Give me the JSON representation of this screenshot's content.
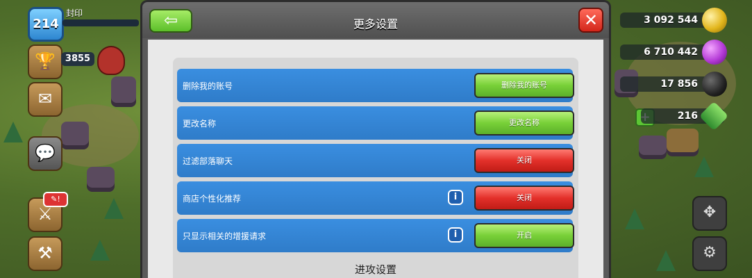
{
  "player": {
    "level": "214",
    "name": "封印",
    "trophies": "3855"
  },
  "resources": {
    "gold": "3 092 544",
    "elixir": "6 710 442",
    "dark_elixir": "17 856",
    "gems": "216"
  },
  "dialog": {
    "title": "更多设置",
    "back_icon": "left-arrow-icon",
    "close_icon": "close-x-icon",
    "rows": [
      {
        "label": "删除我的账号",
        "button": "删除我的账号",
        "color": "#78d038",
        "has_info": false
      },
      {
        "label": "更改名称",
        "button": "更改名称",
        "color": "#78d038",
        "has_info": false
      },
      {
        "label": "过滤部落聊天",
        "button": "关闭",
        "color": "#e3302a",
        "has_info": false
      },
      {
        "label": "商店个性化推荐",
        "button": "关闭",
        "color": "#e3302a",
        "has_info": true
      },
      {
        "label": "只显示相关的增援请求",
        "button": "开启",
        "color": "#78d038",
        "has_info": true
      }
    ],
    "section_title": "进攻设置"
  },
  "colors": {
    "row_blue": "#2f7cc9",
    "green": "#78d038",
    "red": "#e3302a"
  }
}
